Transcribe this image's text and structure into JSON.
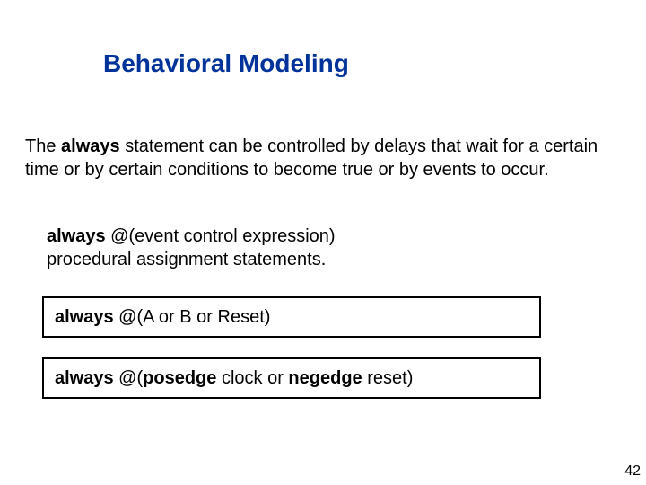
{
  "title": "Behavioral Modeling",
  "intro": {
    "t1": "The ",
    "kw1": "always",
    "t2": " statement can be controlled by delays that wait for a certain time or by certain conditions to become true or by events to occur."
  },
  "syntax": {
    "kw1": "always",
    "t1": " @(event control expression)",
    "t2": "procedural assignment statements."
  },
  "example1": {
    "kw1": "always",
    "t1": " @(A or B or Reset)"
  },
  "example2": {
    "kw1": "always",
    "t1": " @(",
    "kw2": "posedge",
    "t2": " clock or ",
    "kw3": "negedge",
    "t3": " reset)"
  },
  "page": "42"
}
